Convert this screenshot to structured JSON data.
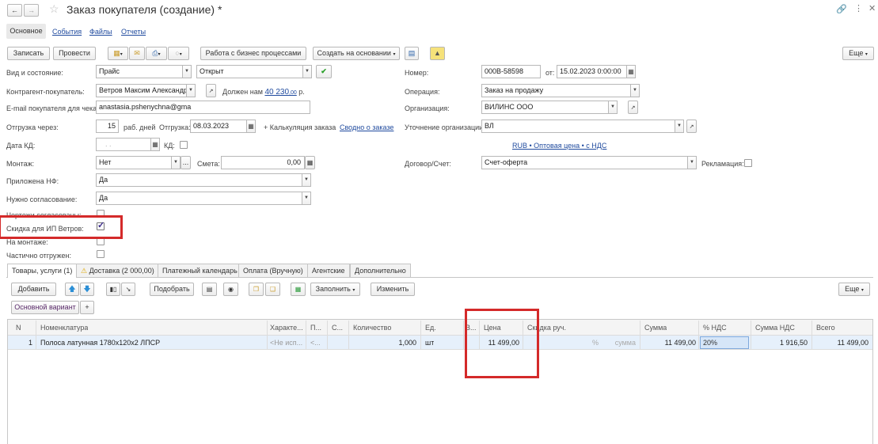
{
  "window": {
    "title": "Заказ покупателя (создание) *",
    "back_icon": "arrow-left-icon",
    "forward_icon": "arrow-right-icon",
    "favorite_icon": "star-icon",
    "link_icon": "link-icon",
    "menu_icon": "more-vertical-icon",
    "close_icon": "close-icon"
  },
  "nav_tabs": {
    "main": "Основное",
    "events": "События",
    "files": "Файлы",
    "reports": "Отчеты"
  },
  "toolbar": {
    "save": "Записать",
    "post": "Провести",
    "business_processes": "Работа с бизнес процессами",
    "create_based_on": "Создать на основании",
    "more": "Еще"
  },
  "form": {
    "view_state_label": "Вид и состояние:",
    "view_value": "Прайс",
    "state_value": "Открыт",
    "number_label": "Номер:",
    "number_value": "000В-58598",
    "date_label": "от:",
    "date_value": "15.02.2023  0:00:00",
    "counterparty_label": "Контрагент-покупатель:",
    "counterparty_value": "Ветров Максим Александрові",
    "debt_text": "Должен нам",
    "debt_amount": "40 230",
    "debt_cents": ",00",
    "debt_currency": "р.",
    "operation_label": "Операция:",
    "operation_value": "Заказ на продажу",
    "email_label": "E-mail покупателя для чека:",
    "email_value": "anastasia.pshenychna@gma",
    "organization_label": "Организация:",
    "organization_value": "ВИЛИНС ООО",
    "shipping_label": "Отгрузка через:",
    "shipping_days": "15",
    "shipping_days_unit": "раб. дней",
    "shipping_date_label": "Отгрузка:",
    "shipping_date_value": "08.03.2023",
    "calc_text": "+ Калькуляция заказа",
    "summary_link": "Сводно о заказе",
    "org_clarify_label": "Уточнение организации:",
    "org_clarify_value": "ВЛ",
    "kd_date_label": "Дата КД:",
    "kd_date_value": ". .",
    "kd_label": "КД:",
    "price_type_link": "RUB • Оптовая цена • с НДС",
    "mounting_label": "Монтаж:",
    "mounting_value": "Нет",
    "estimate_label": "Смета:",
    "estimate_value": "0,00",
    "contract_label": "Договор/Счет:",
    "contract_value": "Счет-оферта",
    "complaint_label": "Рекламация:",
    "nf_attached_label": "Приложена НФ:",
    "nf_attached_value": "Да",
    "approval_label": "Нужно согласование:",
    "approval_value": "Да",
    "drawings_label": "Чертежи согласованы:",
    "discount_label": "Скидка для ИП Ветров:",
    "on_mounting_label": "На монтаже:",
    "partial_label": "Частично отгружен:"
  },
  "content_tabs": [
    "Товары, услуги (1)",
    "Доставка (2 000,00)",
    "Платежный календарь",
    "Оплата (Вручную)",
    "Агентские",
    "Дополнительно"
  ],
  "table_toolbar": {
    "add": "Добавить",
    "pick": "Подобрать",
    "fill": "Заполнить",
    "change": "Изменить",
    "more": "Еще"
  },
  "variant": {
    "label": "Основной вариант",
    "add": "+"
  },
  "table": {
    "columns": [
      "N",
      "Номенклатура",
      "Характе...",
      "П...",
      "С...",
      "Количество",
      "Ед.",
      "В...",
      "Цена",
      "Скидка руч.",
      "Сумма",
      "% НДС",
      "Сумма НДС",
      "Всего"
    ],
    "rows": [
      {
        "n": "1",
        "nomenclature": "Полоса латунная 1780х120х2 ЛПСР",
        "characteristic": "<Не исп...",
        "p": "<...",
        "quantity": "1,000",
        "unit": "шт",
        "price": "11 499,00",
        "discount_pct": "%",
        "discount_sum": "сумма",
        "sum": "11 499,00",
        "vat_rate": "20%",
        "vat_sum": "1 916,50",
        "total": "11 499,00"
      }
    ]
  },
  "colors": {
    "highlight": "#d42a2a",
    "row_selected": "#e6f0fb",
    "link": "#1f4a9e"
  }
}
